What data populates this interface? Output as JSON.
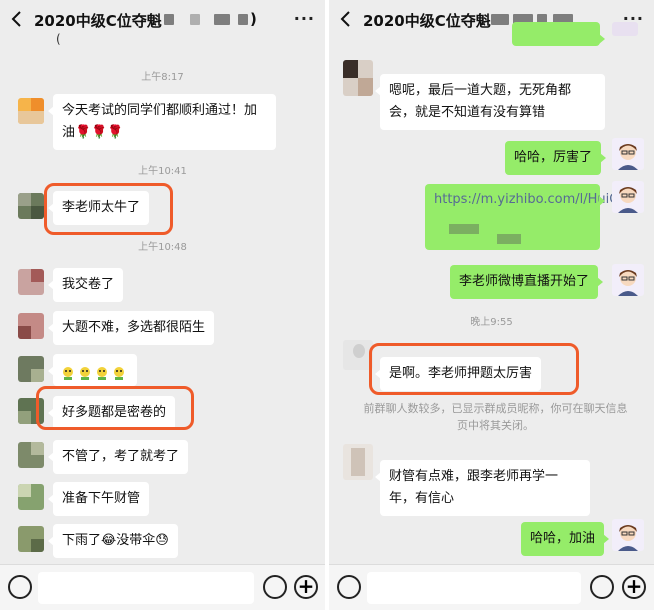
{
  "left": {
    "title": "2020中级C位夺魁",
    "title_suffix": ")",
    "more": "···",
    "top_cut": "(",
    "times": [
      "上午8:17",
      "上午10:41",
      "上午10:48"
    ],
    "messages": [
      "今天考试的同学们都顺利通过！加油🌹🌹🌹",
      "李老师太牛了",
      "我交卷了",
      "大题不难，多选都很陌生",
      "",
      "好多题都是密卷的",
      "不管了，考了就考了",
      "准备下午财管",
      "下雨了😂没带伞😓"
    ]
  },
  "right": {
    "title": "2020中级C位夺魁",
    "more": "···",
    "times": [
      "晚上9:55"
    ],
    "messages": [
      "嗯呢，最后一道大题，无死角都会，就是不知道有没有算错",
      "哈哈，厉害了",
      "https://m.yizhibo.com/l/HuiQ...",
      "李老师微博直播开始了",
      "是啊。李老师押题太厉害",
      "财管有点难，跟李老师再学一年，有信心",
      "哈哈，加油"
    ],
    "system_notice": "前群聊人数较多，已显示群成员昵称，你可在聊天信息页中将其关闭。"
  },
  "colors": {
    "highlight": "#ef5b2a",
    "green_bubble": "#95ec69",
    "link": "#576b95"
  },
  "icons": [
    "back-icon",
    "more-icon",
    "voice-icon",
    "emoji-icon",
    "plus-icon"
  ]
}
